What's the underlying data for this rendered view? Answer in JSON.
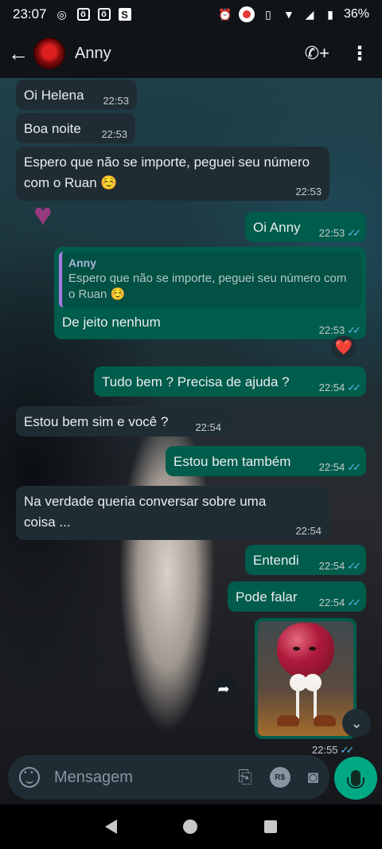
{
  "status": {
    "time": "23:07",
    "battery": "36%"
  },
  "header": {
    "contact_name": "Anny"
  },
  "messages": [
    {
      "dir": "in",
      "text": "Oi Helena",
      "time": "22:53"
    },
    {
      "dir": "in",
      "text": "Boa noite",
      "time": "22:53"
    },
    {
      "dir": "in",
      "text": "Espero que não se importe, peguei seu número com o Ruan ☺️",
      "time": "22:53"
    },
    {
      "dir": "out",
      "text": "Oi Anny",
      "time": "22:53"
    },
    {
      "dir": "out",
      "text": "De jeito nenhum",
      "time": "22:53",
      "quote_name": "Anny",
      "quote_text": "Espero que não se importe, peguei seu número com o Ruan ☺️",
      "reaction": "❤️"
    },
    {
      "dir": "out",
      "text": "Tudo bem ? Precisa de ajuda ?",
      "time": "22:54"
    },
    {
      "dir": "in",
      "text": "Estou bem sim e você ?",
      "time": "22:54"
    },
    {
      "dir": "out",
      "text": "Estou bem também",
      "time": "22:54"
    },
    {
      "dir": "in",
      "text": "Na verdade queria conversar sobre uma coisa ...",
      "time": "22:54"
    },
    {
      "dir": "out",
      "text": "Entendi",
      "time": "22:54"
    },
    {
      "dir": "out",
      "text": "Pode falar",
      "time": "22:54"
    },
    {
      "dir": "out",
      "type": "sticker",
      "time": "22:55"
    }
  ],
  "composer": {
    "placeholder": "Mensagem",
    "currency_label": "R$"
  },
  "icons": {
    "read_ticks": "✓✓"
  }
}
